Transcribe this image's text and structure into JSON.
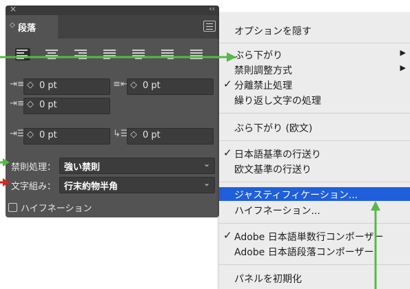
{
  "panel": {
    "close_glyph": "×",
    "collapse_glyph": "‹‹",
    "tab": {
      "arrow": "◇",
      "label": "段落"
    },
    "fields": [
      {
        "value": "0 pt"
      },
      {
        "value": "0 pt"
      },
      {
        "value": "0 pt"
      },
      {
        "value": "0 pt"
      },
      {
        "value": "0 pt"
      }
    ],
    "kinsoku": {
      "label": "禁則処理：",
      "value": "強い禁則"
    },
    "mojikumi": {
      "label": "文字組み：",
      "value": "行末約物半角"
    },
    "hyphenation": {
      "label": "ハイフネーション",
      "checked": false
    }
  },
  "menu": {
    "items": [
      {
        "label": "オプションを隠す"
      },
      {
        "label": "ぶら下がり",
        "submenu": true
      },
      {
        "label": "禁則調整方式",
        "submenu": true
      },
      {
        "label": "分離禁止処理",
        "checked": true
      },
      {
        "label": "繰り返し文字の処理"
      },
      {
        "label": "ぶら下がり (欧文)"
      },
      {
        "label": "日本語基準の行送り",
        "checked": true
      },
      {
        "label": "欧文基準の行送り"
      },
      {
        "label": "ジャスティフィケーション...",
        "highlighted": true
      },
      {
        "label": "ハイフネーション..."
      },
      {
        "label": "Adobe 日本語単数行コンポーザー",
        "checked": true
      },
      {
        "label": "Adobe 日本語段落コンポーザー"
      },
      {
        "label": "パネルを初期化"
      }
    ],
    "check_glyph": "✓",
    "submenu_glyph": "▶"
  },
  "annotation_colors": {
    "green": "#57b84a",
    "red": "#d9261c"
  }
}
